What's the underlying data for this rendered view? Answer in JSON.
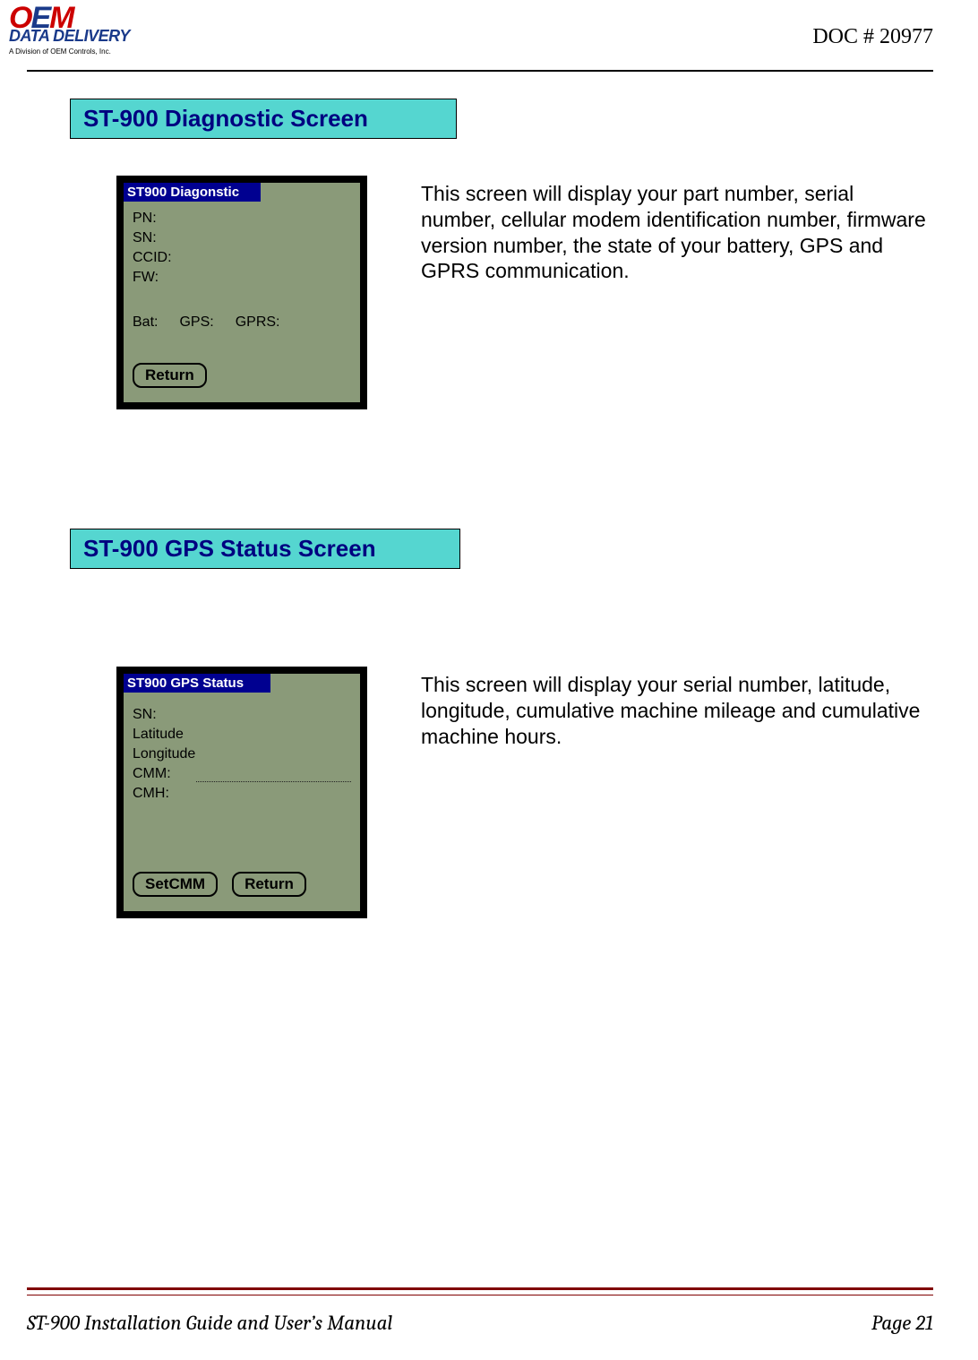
{
  "header": {
    "logo_line1_o": "O",
    "logo_line1_e": "E",
    "logo_line1_m": "M",
    "logo_line2": "DATA DELIVERY",
    "logo_sub": "A Division of OEM Controls, Inc.",
    "doc_number": "DOC # 20977"
  },
  "section1": {
    "title": "ST-900 Diagnostic Screen",
    "device": {
      "titlebar": "ST900 Diagonstic",
      "fields": {
        "pn": "PN:",
        "sn": "SN:",
        "ccid": "CCID:",
        "fw": "FW:",
        "bat": "Bat:",
        "gps": "GPS:",
        "gprs": "GPRS:"
      },
      "buttons": {
        "return": "Return"
      }
    },
    "description": "This screen will display your part number, serial number, cellular modem identification number, firmware version number, the state of your battery, GPS and GPRS communication."
  },
  "section2": {
    "title": "ST-900 GPS Status Screen",
    "device": {
      "titlebar": "ST900 GPS Status",
      "fields": {
        "sn": "SN:",
        "lat": "Latitude",
        "lon": "Longitude",
        "cmm": "CMM:",
        "cmh": "CMH:"
      },
      "buttons": {
        "setcmm": "SetCMM",
        "return": "Return"
      }
    },
    "description": "This screen will display your serial number, latitude, longitude, cumulative machine mileage and cumulative machine hours."
  },
  "footer": {
    "left": "ST-900 Installation Guide and User’s Manual",
    "right": "Page 21"
  }
}
